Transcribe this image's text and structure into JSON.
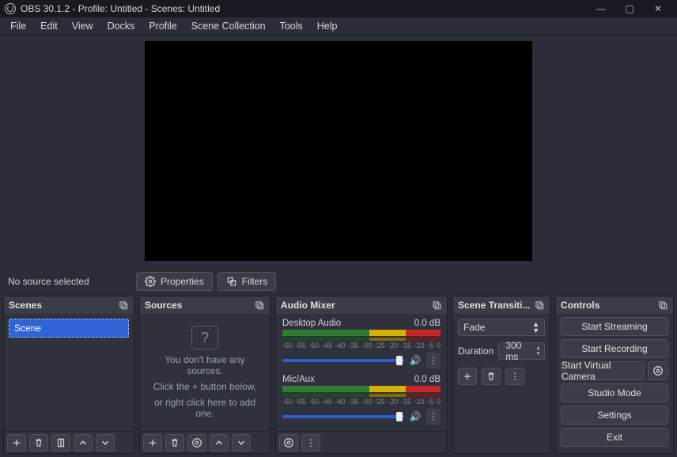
{
  "titlebar": {
    "text": "OBS 30.1.2 - Profile: Untitled - Scenes: Untitled"
  },
  "menu": [
    "File",
    "Edit",
    "View",
    "Docks",
    "Profile",
    "Scene Collection",
    "Tools",
    "Help"
  ],
  "toolbar": {
    "status": "No source selected",
    "properties": "Properties",
    "filters": "Filters"
  },
  "docks": {
    "scenes": {
      "title": "Scenes",
      "items": [
        "Scene"
      ]
    },
    "sources": {
      "title": "Sources",
      "empty1": "You don't have any sources.",
      "empty2": "Click the + button below,",
      "empty3": "or right click here to add one."
    },
    "mixer": {
      "title": "Audio Mixer",
      "ticks": [
        "-60",
        "-55",
        "-50",
        "-45",
        "-40",
        "-35",
        "-30",
        "-25",
        "-20",
        "-15",
        "-10",
        "-5",
        "0"
      ],
      "channels": [
        {
          "name": "Desktop Audio",
          "level": "0.0 dB"
        },
        {
          "name": "Mic/Aux",
          "level": "0.0 dB"
        }
      ]
    },
    "transitions": {
      "title": "Scene Transiti...",
      "selected": "Fade",
      "duration_label": "Duration",
      "duration_value": "300 ms"
    },
    "controls": {
      "title": "Controls",
      "buttons": {
        "stream": "Start Streaming",
        "record": "Start Recording",
        "vcam": "Start Virtual Camera",
        "studio": "Studio Mode",
        "settings": "Settings",
        "exit": "Exit"
      }
    }
  }
}
